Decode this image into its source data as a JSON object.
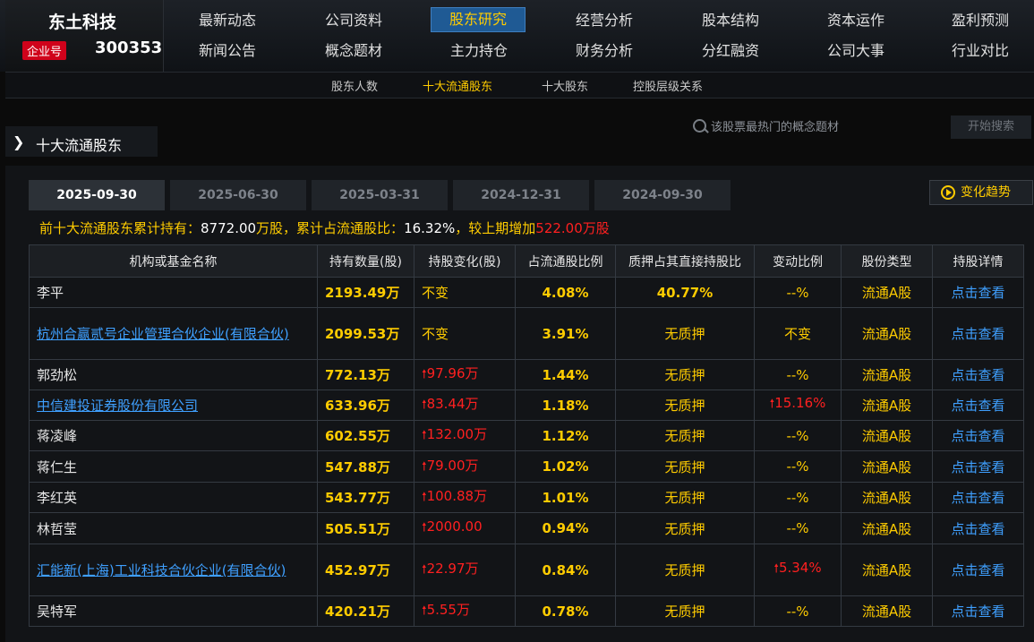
{
  "stock": {
    "name": "东土科技",
    "badge": "企业号",
    "code": "300353"
  },
  "nav": {
    "row1": [
      "最新动态",
      "公司资料",
      "股东研究",
      "经营分析",
      "股本结构",
      "资本运作",
      "盈利预测"
    ],
    "row2": [
      "新闻公告",
      "概念题材",
      "主力持仓",
      "财务分析",
      "分红融资",
      "公司大事",
      "行业对比"
    ],
    "active": "股东研究"
  },
  "subnav": {
    "items": [
      "股东人数",
      "十大流通股东",
      "十大股东",
      "控股层级关系"
    ],
    "active": "十大流通股东"
  },
  "search": {
    "placeholder": "该股票最热门的概念题材",
    "button": "开始搜索"
  },
  "section": {
    "title": "十大流通股东"
  },
  "tabs": [
    "2025-09-30",
    "2025-06-30",
    "2025-03-31",
    "2024-12-31",
    "2024-09-30"
  ],
  "active_tab": "2025-09-30",
  "trend_button": "变化趋势",
  "summary": {
    "prefix": "前十大流通股东累计持有：",
    "total": "8772.00",
    "unit1": "万股，累计占流通股比：",
    "ratio": "16.32%",
    "mid": "，较上期增加",
    "increase": "522.00万股"
  },
  "table": {
    "headers": [
      "机构或基金名称",
      "持有数量(股)",
      "持股变化(股)",
      "占流通股比例",
      "质押占其直接持股比",
      "变动比例",
      "股份类型",
      "持股详情"
    ],
    "rows": [
      {
        "name": "李平",
        "link": false,
        "qty": "2193.49万",
        "change": "不变",
        "change_up": false,
        "pct": "4.08%",
        "pledge": "40.77%",
        "var": "--%",
        "var_up": false,
        "type": "流通A股",
        "detail": "点击查看"
      },
      {
        "name": "杭州合赢贰号企业管理合伙企业(有限合伙)",
        "link": true,
        "qty": "2099.53万",
        "change": "不变",
        "change_up": false,
        "pct": "3.91%",
        "pledge": "无质押",
        "var": "不变",
        "var_up": false,
        "type": "流通A股",
        "detail": "点击查看"
      },
      {
        "name": "郭劲松",
        "link": false,
        "qty": "772.13万",
        "change": "97.96万",
        "change_up": true,
        "pct": "1.44%",
        "pledge": "无质押",
        "var": "--%",
        "var_up": false,
        "type": "流通A股",
        "detail": "点击查看"
      },
      {
        "name": "中信建投证券股份有限公司",
        "link": true,
        "qty": "633.96万",
        "change": "83.44万",
        "change_up": true,
        "pct": "1.18%",
        "pledge": "无质押",
        "var": "15.16%",
        "var_up": true,
        "type": "流通A股",
        "detail": "点击查看"
      },
      {
        "name": "蒋凌峰",
        "link": false,
        "qty": "602.55万",
        "change": "132.00万",
        "change_up": true,
        "pct": "1.12%",
        "pledge": "无质押",
        "var": "--%",
        "var_up": false,
        "type": "流通A股",
        "detail": "点击查看"
      },
      {
        "name": "蒋仁生",
        "link": false,
        "qty": "547.88万",
        "change": "79.00万",
        "change_up": true,
        "pct": "1.02%",
        "pledge": "无质押",
        "var": "--%",
        "var_up": false,
        "type": "流通A股",
        "detail": "点击查看"
      },
      {
        "name": "李红英",
        "link": false,
        "qty": "543.77万",
        "change": "100.88万",
        "change_up": true,
        "pct": "1.01%",
        "pledge": "无质押",
        "var": "--%",
        "var_up": false,
        "type": "流通A股",
        "detail": "点击查看"
      },
      {
        "name": "林哲莹",
        "link": false,
        "qty": "505.51万",
        "change": "2000.00",
        "change_up": true,
        "pct": "0.94%",
        "pledge": "无质押",
        "var": "--%",
        "var_up": false,
        "type": "流通A股",
        "detail": "点击查看"
      },
      {
        "name": "汇能新(上海)工业科技合伙企业(有限合伙)",
        "link": true,
        "qty": "452.97万",
        "change": "22.97万",
        "change_up": true,
        "pct": "0.84%",
        "pledge": "无质押",
        "var": "5.34%",
        "var_up": true,
        "type": "流通A股",
        "detail": "点击查看"
      },
      {
        "name": "吴特军",
        "link": false,
        "qty": "420.21万",
        "change": "5.55万",
        "change_up": true,
        "pct": "0.78%",
        "pledge": "无质押",
        "var": "--%",
        "var_up": false,
        "type": "流通A股",
        "detail": "点击查看"
      }
    ]
  },
  "colors": {
    "accent": "#ffcc00",
    "up": "#ff2020",
    "link": "#3fa0ff",
    "active_nav_bg": "#1f5a94",
    "badge_bg": "#d0021b"
  }
}
